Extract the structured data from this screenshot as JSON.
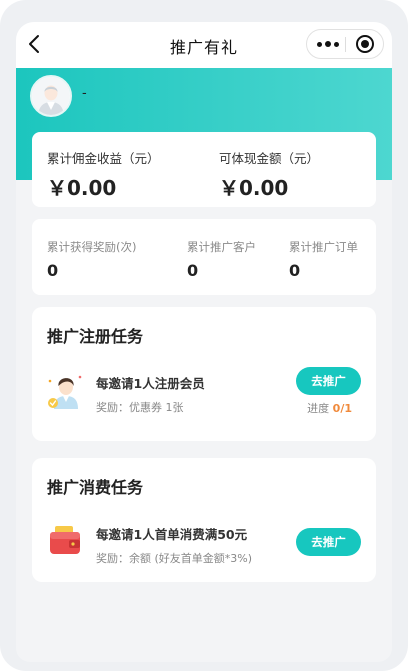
{
  "nav": {
    "title": "推广有礼",
    "back_icon": "chevron-left-icon",
    "more_icon": "more-dots-icon",
    "close_icon": "target-close-icon"
  },
  "theme": {
    "accent": "#17c7bf",
    "banner_start": "#1cc6be",
    "banner_end": "#4dd7d0",
    "progress_color": "#f08a3c"
  },
  "user": {
    "name": "-"
  },
  "earnings": {
    "cumulative_label": "累计佣金收益（元）",
    "cumulative_value": "￥0.00",
    "withdrawable_label": "可体现金额（元）",
    "withdrawable_value": "￥0.00"
  },
  "stats": [
    {
      "label": "累计获得奖励(次)",
      "value": "0"
    },
    {
      "label": "累计推广客户",
      "value": "0"
    },
    {
      "label": "累计推广订单",
      "value": "0"
    }
  ],
  "register_task": {
    "section_title": "推广注册任务",
    "name": "每邀请1人注册会员",
    "reward": "奖励：优惠券 1张",
    "button": "去推广",
    "progress_label": "进度",
    "progress_value": "0/1",
    "icon": "inviting-person-icon"
  },
  "consume_task": {
    "section_title": "推广消费任务",
    "name": "每邀请1人首单消费满50元",
    "reward": "奖励：余额 (好友首单金额*3%)",
    "button": "去推广",
    "icon": "wallet-icon"
  }
}
